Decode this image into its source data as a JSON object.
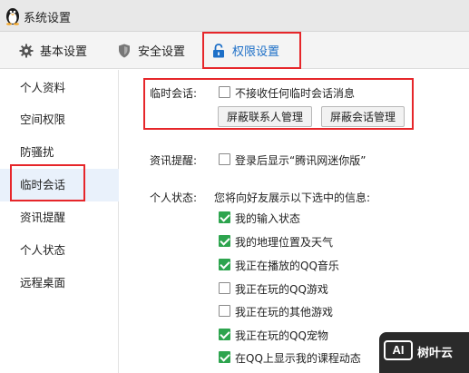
{
  "window": {
    "title": "系统设置"
  },
  "tabs": [
    {
      "label": "基本设置",
      "icon": "gear-icon"
    },
    {
      "label": "安全设置",
      "icon": "shield-icon"
    },
    {
      "label": "权限设置",
      "icon": "lock-icon",
      "active": true
    }
  ],
  "sidebar": {
    "items": [
      {
        "label": "个人资料"
      },
      {
        "label": "空间权限"
      },
      {
        "label": "防骚扰"
      },
      {
        "label": "临时会话",
        "active": true
      },
      {
        "label": "资讯提醒"
      },
      {
        "label": "个人状态"
      },
      {
        "label": "远程桌面"
      }
    ]
  },
  "temp_chat": {
    "label": "临时会话:",
    "block_all": {
      "text": "不接收任何临时会话消息",
      "checked": false
    },
    "btn_contacts": "屏蔽联系人管理",
    "btn_sessions": "屏蔽会话管理"
  },
  "news": {
    "label": "资讯提醒:",
    "option": {
      "text": "登录后显示“腾讯网迷你版”",
      "checked": false
    }
  },
  "status": {
    "label": "个人状态:",
    "intro": "您将向好友展示以下选中的信息:",
    "options": [
      {
        "text": "我的输入状态",
        "checked": true
      },
      {
        "text": "我的地理位置及天气",
        "checked": true
      },
      {
        "text": "我正在播放的QQ音乐",
        "checked": true
      },
      {
        "text": "我正在玩的QQ游戏",
        "checked": false
      },
      {
        "text": "我正在玩的其他游戏",
        "checked": false
      },
      {
        "text": "我正在玩的QQ宠物",
        "checked": true
      },
      {
        "text": "在QQ上显示我的课程动态",
        "checked": true
      }
    ]
  },
  "watermark": {
    "badge": "AI",
    "text": "树叶云"
  },
  "colors": {
    "accent": "#1d6fc7",
    "check_green": "#2da44e",
    "highlight_red": "#e6262a"
  }
}
